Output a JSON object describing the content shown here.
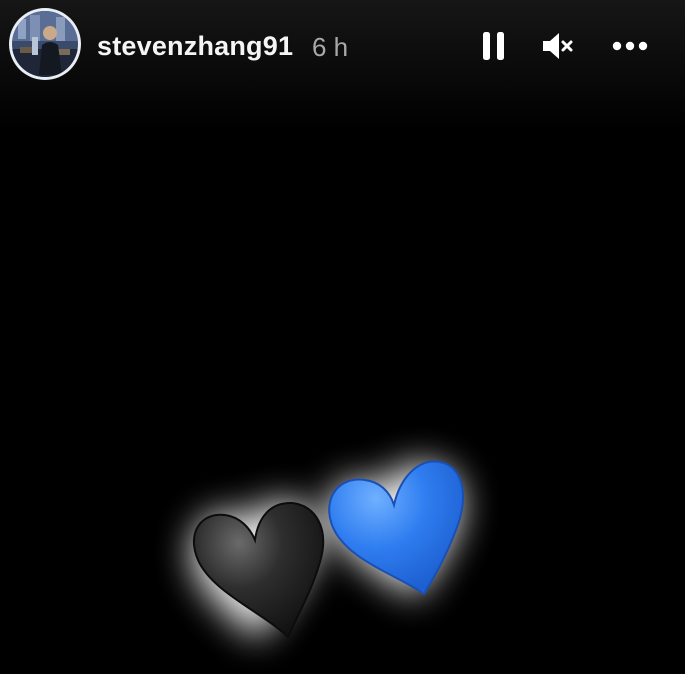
{
  "header": {
    "username": "stevenzhang91",
    "timestamp": "6 h"
  },
  "controls": {
    "pause_icon": "pause-icon",
    "mute_icon": "speaker-muted-icon",
    "more_icon": "more-options-icon"
  },
  "content": {
    "emojis": [
      "black-heart",
      "blue-heart"
    ]
  },
  "colors": {
    "background": "#000000",
    "text": "#f5f5f5",
    "timestamp": "#a8a8a8",
    "blue_heart": "#2f7df0",
    "black_heart": "#2a2a2a"
  }
}
